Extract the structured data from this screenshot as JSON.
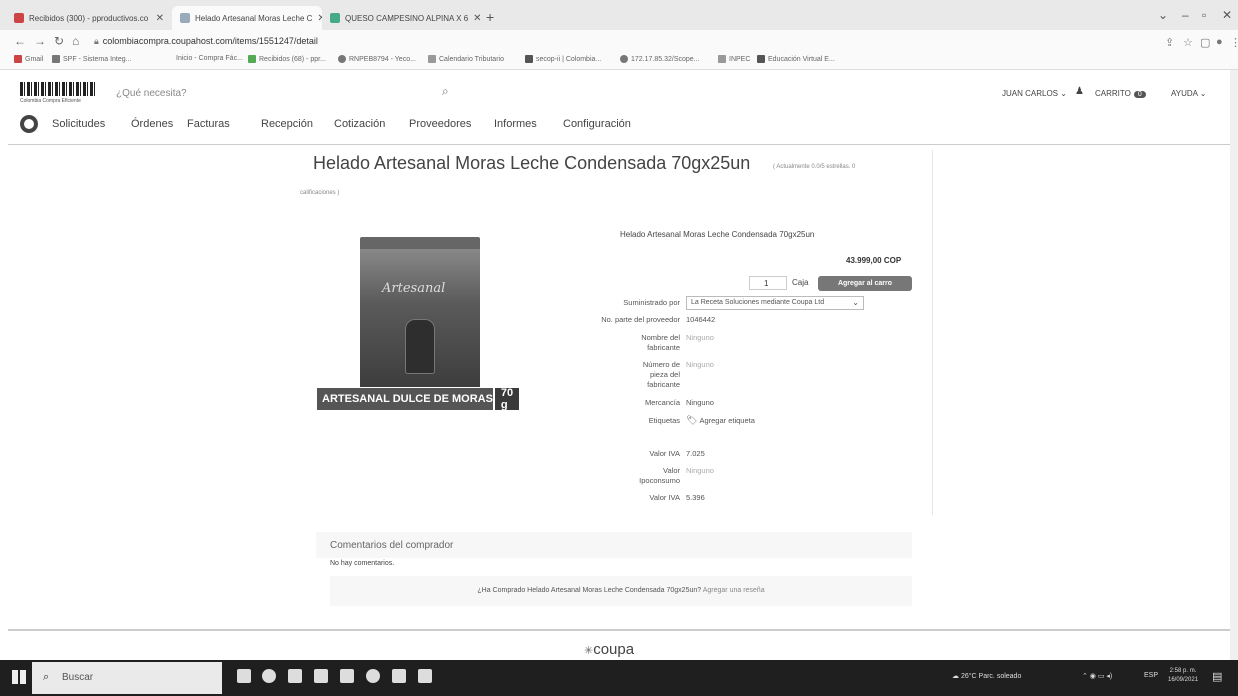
{
  "browser": {
    "tabs": [
      {
        "title": "Recibidos (300) - pproductivos.co"
      },
      {
        "title": "Helado Artesanal Moras Leche C"
      },
      {
        "title": "QUESO CAMPESINO ALPINA X 6"
      }
    ],
    "url": "colombiacompra.coupahost.com/items/1551247/detail",
    "bookmarks": [
      "Gmail",
      "SPF - Sistema Integ...",
      "Inicio - Compra Fác...",
      "Recibidos (68) - ppr...",
      "RNPEB8794 - Yeco...",
      "Calendario Tributario",
      "secop-ii | Colombia...",
      "172.17.85.32/Scope...",
      "INPEC",
      "Educación Virtual E..."
    ]
  },
  "header": {
    "logo_text": "Colombia Compra Eficiente",
    "search_placeholder": "¿Qué necesita?",
    "user_name": "JUAN CARLOS",
    "cart_label": "CARRITO",
    "cart_count": "0",
    "help_label": "AYUDA"
  },
  "nav": {
    "items": [
      "Solicitudes",
      "Órdenes",
      "Facturas",
      "Recepción",
      "Cotización",
      "Proveedores",
      "Informes",
      "Configuración"
    ]
  },
  "product": {
    "title": "Helado Artesanal Moras Leche Condensada 70gx25un",
    "rating_text": "( Actualmente 0.0/5 estrellas. 0",
    "rating_text2": "calificaciones )",
    "subtitle": "Helado Artesanal Moras Leche Condensada 70gx25un",
    "price": "43.999,00 COP",
    "quantity": "1",
    "unit": "Caja",
    "add_to_cart": "Agregar al carro",
    "package_script": "Artesanal",
    "package_name": "ARTESANAL DULCE DE MORAS",
    "package_weight": "70 g",
    "attributes": {
      "supplied_by_label": "Suministrado por",
      "supplied_by_value": "La Receta Soluciones mediante Coupa Ltd",
      "part_no_label": "No. parte del proveedor",
      "part_no_value": "1046442",
      "manufacturer_name_label": "Nombre del fabricante",
      "manufacturer_name_value": "Ninguno",
      "manufacturer_part_label": "Número de pieza del fabricante",
      "manufacturer_part_value": "Ninguno",
      "commodity_label": "Mercancía",
      "commodity_value": "Ninguno",
      "tags_label": "Etiquetas",
      "tags_value": "Agregar etiqueta",
      "iva_label": "Valor IVA",
      "iva_value": "7.025",
      "consumo_label": "Valor Ipoconsumo",
      "consumo_value": "Ninguno",
      "ivb_label": "Valor IVA",
      "ivb_value": "5.396"
    }
  },
  "comments": {
    "header": "Comentarios del comprador",
    "empty": "No hay comentarios.",
    "prompt": "¿Ha Comprado Helado Artesanal Moras Leche Condensada 70gx25un?",
    "review_link": "Agregar una reseña"
  },
  "footer": {
    "brand": "coupa"
  },
  "taskbar": {
    "search_placeholder": "Buscar",
    "weather": "26°C  Parc. soleado",
    "language": "ESP",
    "time": "2:58 p. m.",
    "date": "16/09/2021"
  }
}
